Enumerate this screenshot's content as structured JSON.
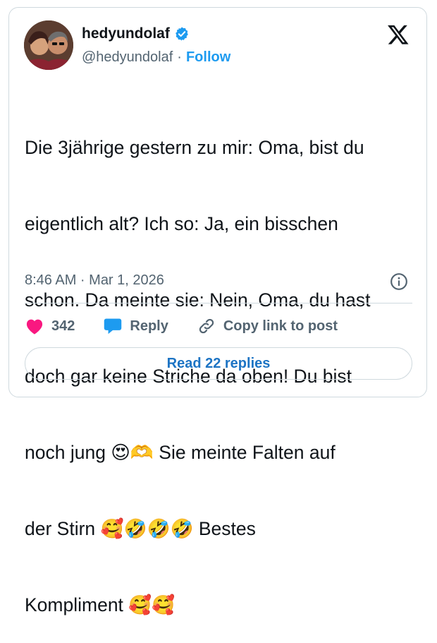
{
  "author": {
    "display_name": "hedyundolaf",
    "handle": "@hedyundolaf",
    "separator": "·",
    "follow_label": "Follow"
  },
  "tweet": {
    "text_lines": [
      "Die 3jährige gestern zu mir: Oma, bist du",
      "eigentlich alt? Ich so: Ja, ein bisschen",
      "schon. Da meinte sie: Nein, Oma, du hast",
      "doch gar keine Striche da oben! Du bist",
      "noch jung 😍🫶 Sie meinte Falten auf",
      "der Stirn 🥰🤣🤣🤣 Bestes",
      "Kompliment 🥰🥰"
    ],
    "timestamp": "8:46 AM · Mar 1, 2026"
  },
  "actions": {
    "like_count": "342",
    "reply_label": "Reply",
    "copy_label": "Copy link to post"
  },
  "read_replies_label": "Read 22 replies",
  "colors": {
    "accent": "#1d9bf0",
    "heart": "#f91880",
    "muted": "#536471",
    "border": "#cfd9de"
  },
  "icons": [
    "verified-badge-icon",
    "x-logo-icon",
    "info-icon",
    "heart-icon",
    "reply-bubble-icon",
    "link-icon"
  ]
}
